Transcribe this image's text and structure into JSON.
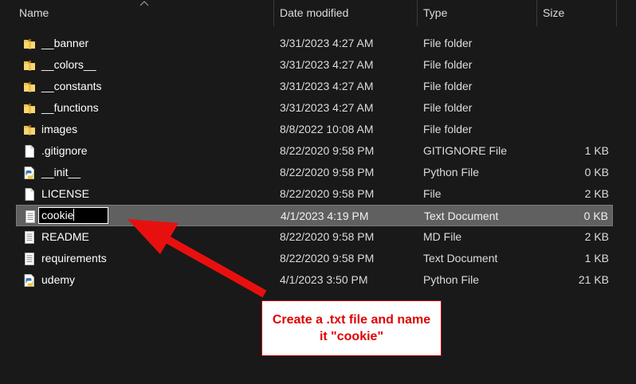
{
  "columns": {
    "name": "Name",
    "date": "Date modified",
    "type": "Type",
    "size": "Size"
  },
  "files": [
    {
      "name": "__banner",
      "date": "3/31/2023 4:27 AM",
      "type": "File folder",
      "size": "",
      "icon": "folder-icon"
    },
    {
      "name": "__colors__",
      "date": "3/31/2023 4:27 AM",
      "type": "File folder",
      "size": "",
      "icon": "folder-icon"
    },
    {
      "name": "__constants",
      "date": "3/31/2023 4:27 AM",
      "type": "File folder",
      "size": "",
      "icon": "folder-icon"
    },
    {
      "name": "__functions",
      "date": "3/31/2023 4:27 AM",
      "type": "File folder",
      "size": "",
      "icon": "folder-icon"
    },
    {
      "name": "images",
      "date": "8/8/2022 10:08 AM",
      "type": "File folder",
      "size": "",
      "icon": "folder-icon"
    },
    {
      "name": ".gitignore",
      "date": "8/22/2020 9:58 PM",
      "type": "GITIGNORE File",
      "size": "1 KB",
      "icon": "blank-file-icon"
    },
    {
      "name": "__init__",
      "date": "8/22/2020 9:58 PM",
      "type": "Python File",
      "size": "0 KB",
      "icon": "python-file-icon"
    },
    {
      "name": "LICENSE",
      "date": "8/22/2020 9:58 PM",
      "type": "File",
      "size": "2 KB",
      "icon": "blank-file-icon"
    },
    {
      "name": "cookie",
      "date": "4/1/2023 4:19 PM",
      "type": "Text Document",
      "size": "0 KB",
      "icon": "text-file-icon",
      "selected": true,
      "renaming": true
    },
    {
      "name": "README",
      "date": "8/22/2020 9:58 PM",
      "type": "MD File",
      "size": "2 KB",
      "icon": "text-file-icon"
    },
    {
      "name": "requirements",
      "date": "8/22/2020 9:58 PM",
      "type": "Text Document",
      "size": "1 KB",
      "icon": "text-file-icon"
    },
    {
      "name": "udemy",
      "date": "4/1/2023 3:50 PM",
      "type": "Python File",
      "size": "21 KB",
      "icon": "python-file-icon"
    }
  ],
  "callout": {
    "text": "Create a .txt file and name it \"cookie\""
  },
  "colors": {
    "background": "#191919",
    "selected_row": "#606060",
    "folder": "#f3c24b",
    "annotation_red": "#e00000"
  }
}
